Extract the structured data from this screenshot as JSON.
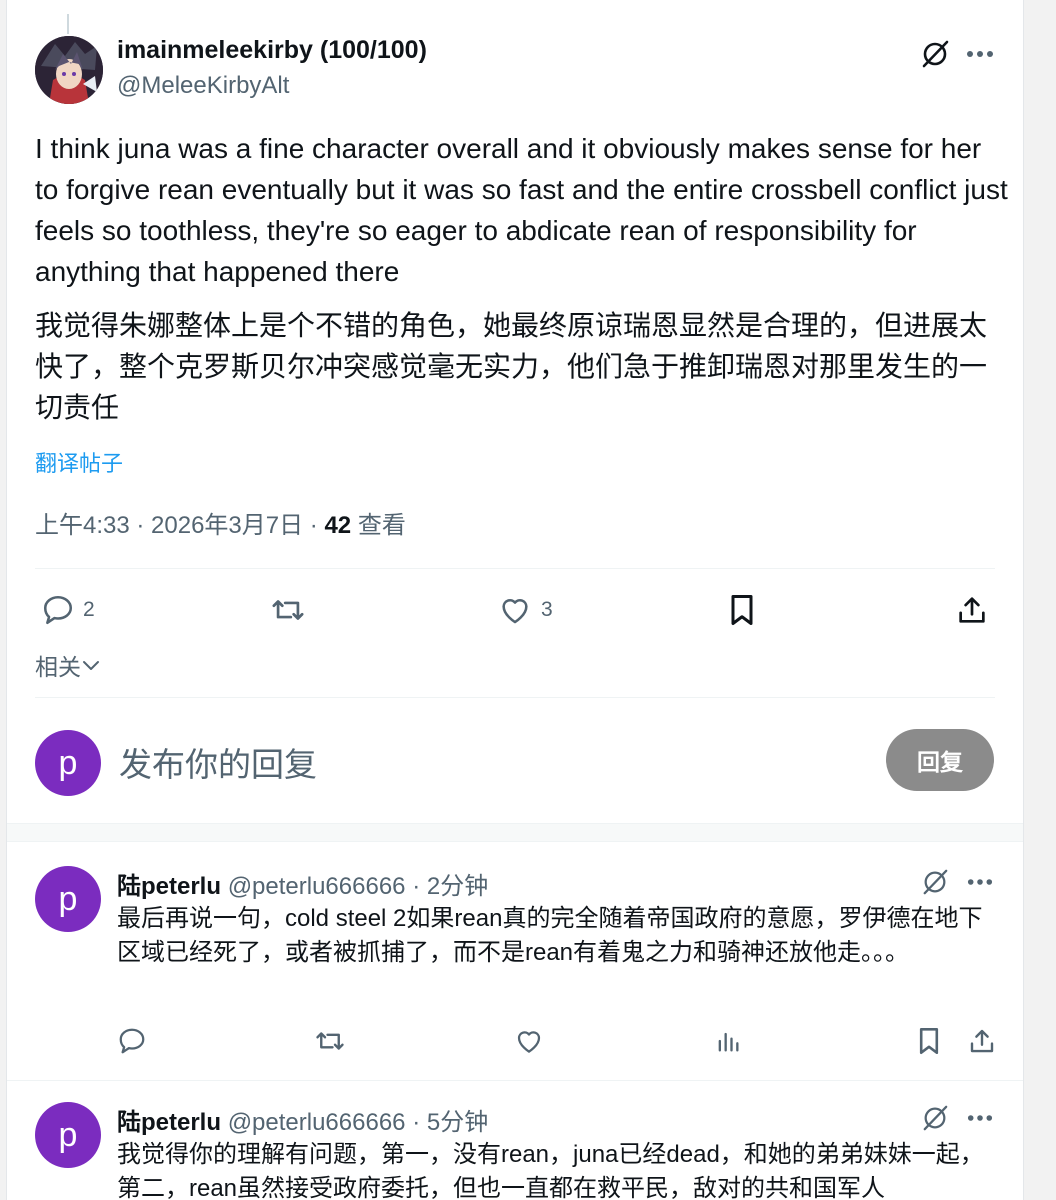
{
  "post": {
    "author_name": "imainmeleekirby (100/100)",
    "author_handle": "@MeleeKirbyAlt",
    "body_en": "I think juna was a fine character overall and it obviously makes sense for her to forgive rean eventually but it was so fast and the entire crossbell conflict just feels so toothless, they're so eager to abdicate rean of responsibility for anything that happened there",
    "body_zh": "我觉得朱娜整体上是个不错的角色，她最终原谅瑞恩显然是合理的，但进展太快了，整个克罗斯贝尔冲突感觉毫无实力，他们急于推卸瑞恩对那里发生的一切责任",
    "translate_label": "翻译帖子",
    "timestamp": "上午4:33 · 2026年3月7日 · ",
    "views_count": "42",
    "views_label": "查看",
    "reply_count": "2",
    "like_count": "3",
    "related_label": "相关"
  },
  "composer": {
    "avatar_letter": "p",
    "placeholder": "发布你的回复",
    "button_label": "回复"
  },
  "replies": [
    {
      "avatar_letter": "p",
      "name": "陆peterlu",
      "handle": "@peterlu666666",
      "time": " · 2分钟",
      "text": "最后再说一句，cold steel 2如果rean真的完全随着帝国政府的意愿，罗伊德在地下区域已经死了，或者被抓捕了，而不是rean有着鬼之力和骑神还放他走。。。"
    },
    {
      "avatar_letter": "p",
      "name": "陆peterlu",
      "handle": "@peterlu666666",
      "time": " · 5分钟",
      "text": "我觉得你的理解有问题，第一，没有rean，juna已经dead，和她的弟弟妹妹一起，第二，rean虽然接受政府委托，但也一直都在救平民，敌对的共和国军人"
    }
  ],
  "colors": {
    "accent": "#1d9bf0",
    "avatar_purple": "#7b2cbf",
    "muted_text": "#536471",
    "reply_button": "#8b8b8b"
  },
  "icons": [
    "grok-icon",
    "more-icon",
    "reply-icon",
    "retweet-icon",
    "like-icon",
    "bookmark-icon",
    "share-icon",
    "analytics-icon",
    "chevron-down-icon"
  ]
}
